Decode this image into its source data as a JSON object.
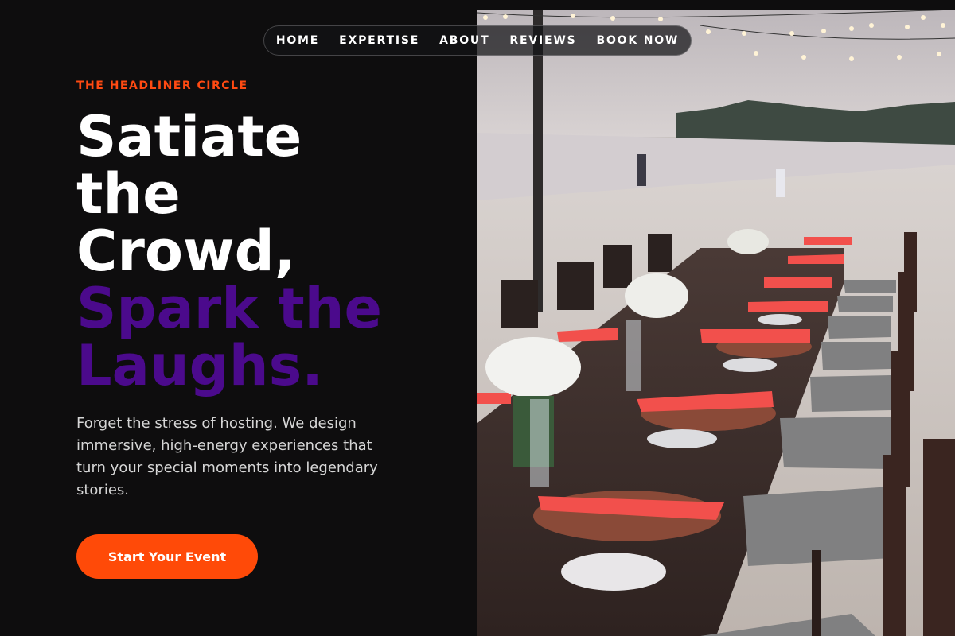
{
  "nav": {
    "items": [
      {
        "label": "HOME"
      },
      {
        "label": "EXPERTISE"
      },
      {
        "label": "ABOUT"
      },
      {
        "label": "REVIEWS"
      },
      {
        "label": "BOOK NOW"
      }
    ]
  },
  "hero": {
    "eyebrow": "THE HEADLINER CIRCLE",
    "headline_lines": [
      "Satiate",
      "the",
      "Crowd,",
      "Spark the",
      "Laughs."
    ],
    "body": "Forget the stress of hosting. We design immersive, high-energy experiences that turn your special moments into legendary stories.",
    "cta_label": "Start Your Event"
  },
  "image": {
    "description": "beach-dinner-table-photo"
  },
  "colors": {
    "background": "#0e0d0e",
    "accent": "#ff4a08",
    "headline_purple": "#4b0a8c"
  }
}
